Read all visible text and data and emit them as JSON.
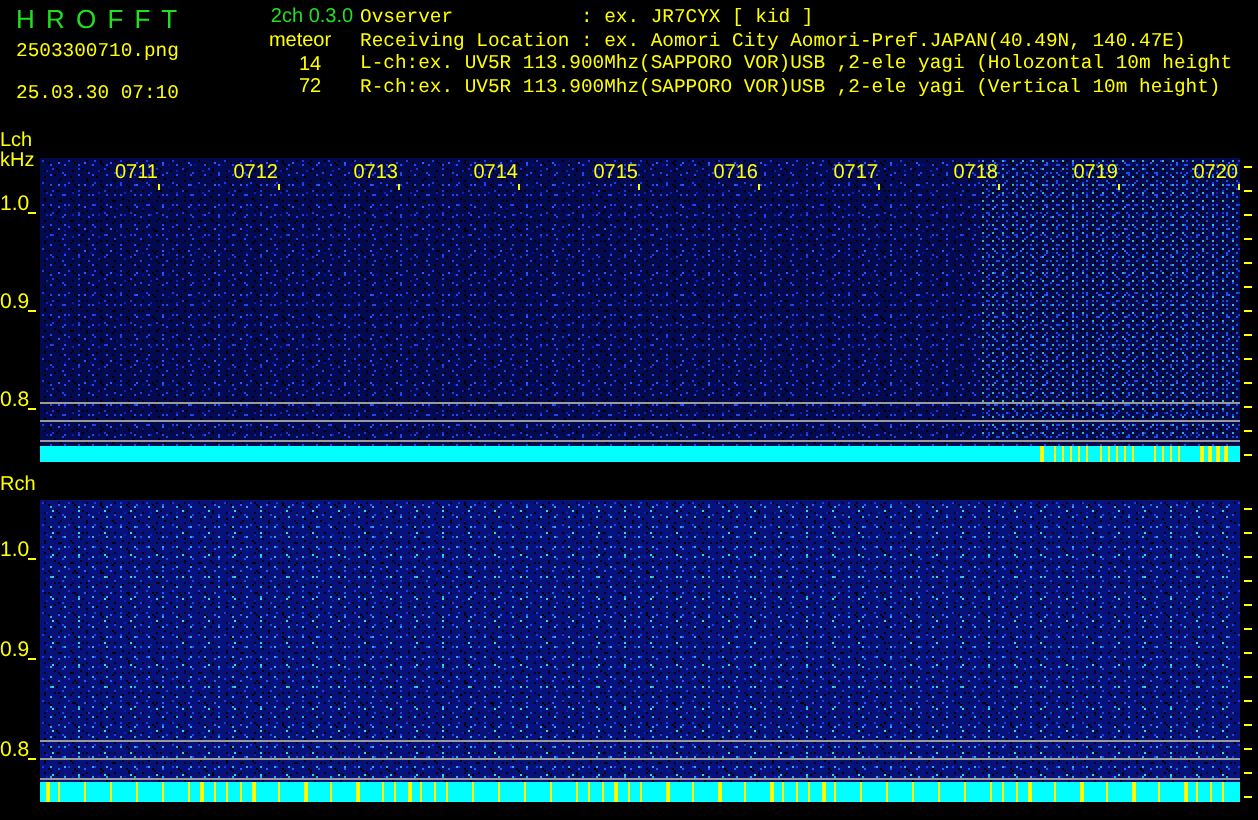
{
  "app": {
    "name": "H R O F F T",
    "version": "2ch 0.3.0",
    "file": "2503300710.png",
    "timestamp": "25.03.30 07:10"
  },
  "meteor": {
    "label": "meteor",
    "counts": [
      "14",
      "72"
    ]
  },
  "info_lines": [
    "Ovserver           : ex. JR7CYX [ kid ]",
    "Receiving Location : ex. Aomori City Aomori-Pref.JAPAN(40.49N, 140.47E)",
    "L-ch:ex. UV5R 113.900Mhz(SAPPORO VOR)USB ,2-ele yagi (Holozontal 10m height",
    "R-ch:ex. UV5R 113.900Mhz(SAPPORO VOR)USB ,2-ele yagi (Vertical 10m height)"
  ],
  "panels": [
    {
      "channel": "Lch",
      "unit": "kHz",
      "times": [
        "0711",
        "0712",
        "0713",
        "0714",
        "0715",
        "0716",
        "0717",
        "0718",
        "0719",
        "0720"
      ],
      "freq_labels": [
        "1.0",
        "0.9",
        "0.8"
      ]
    },
    {
      "channel": "Rch",
      "freq_labels": [
        "1.0",
        "0.9",
        "0.8"
      ]
    }
  ]
}
